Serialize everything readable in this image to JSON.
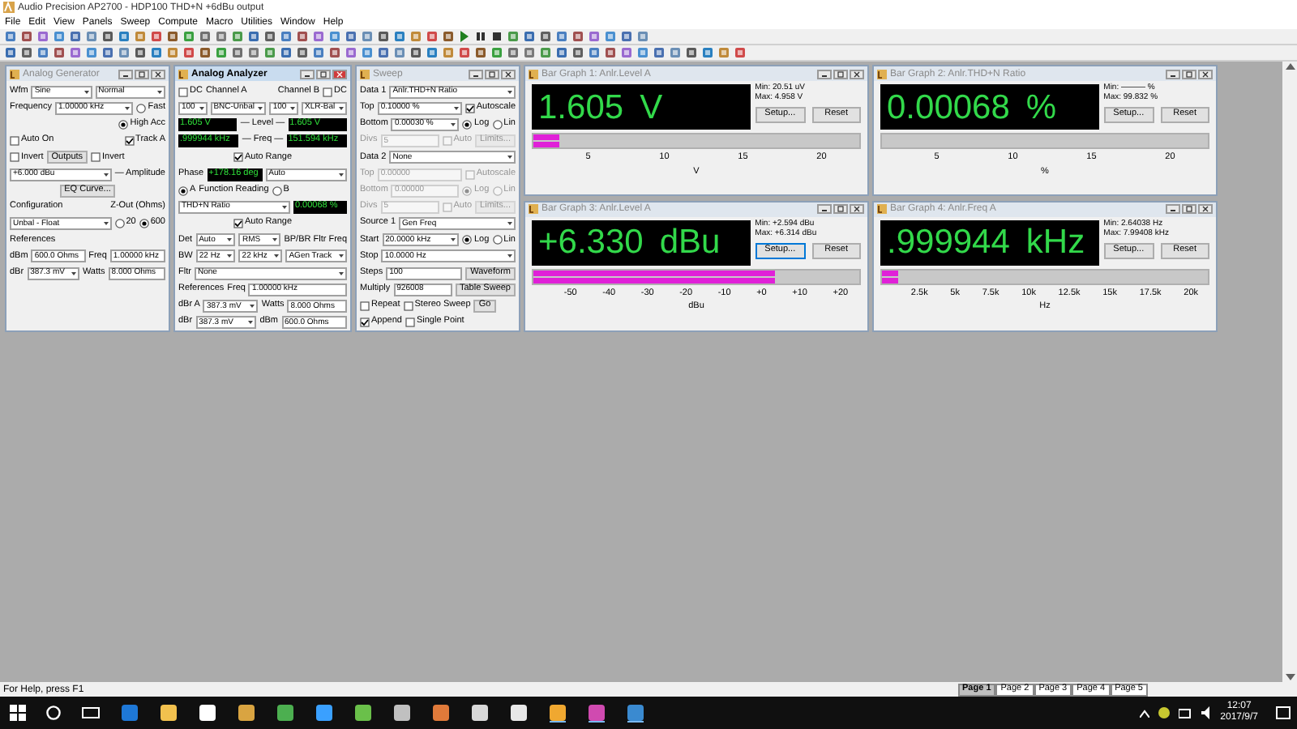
{
  "window": {
    "title": "Audio Precision AP2700 - HDP100 THD+N +6dBu output"
  },
  "menu": [
    "File",
    "Edit",
    "View",
    "Panels",
    "Sweep",
    "Compute",
    "Macro",
    "Utilities",
    "Window",
    "Help"
  ],
  "panels": [
    {
      "title": "Analog Generator",
      "active": false,
      "rows": [
        {
          "items": [
            {
              "kind": "label",
              "text": "Wfm"
            },
            {
              "kind": "select",
              "text": "Sine"
            },
            {
              "kind": "select",
              "text": "Normal"
            }
          ]
        },
        {
          "items": [
            {
              "kind": "label",
              "text": "Frequency"
            },
            {
              "kind": "select",
              "text": "1.00000 kHz"
            },
            {
              "kind": "radio",
              "text": "Fast",
              "selected": false
            }
          ]
        },
        {
          "items": [
            {
              "kind": "spacer"
            },
            {
              "kind": "radio",
              "text": "High Acc",
              "selected": true
            }
          ]
        },
        {
          "items": [
            {
              "kind": "checkbox",
              "text": "Auto On",
              "checked": false
            },
            {
              "kind": "spacer"
            },
            {
              "kind": "checkbox",
              "text": "Track A",
              "checked": true
            }
          ]
        },
        {
          "items": [
            {
              "kind": "checkbox",
              "text": "Invert",
              "checked": false
            },
            {
              "kind": "button",
              "text": "Outputs"
            },
            {
              "kind": "checkbox",
              "text": "Invert",
              "checked": false
            }
          ]
        },
        {
          "items": [
            {
              "kind": "select",
              "text": "+6.000 dBu"
            },
            {
              "kind": "label",
              "text": "— Amplitude"
            }
          ]
        },
        {
          "items": [
            {
              "kind": "spacer"
            },
            {
              "kind": "button",
              "text": "EQ Curve..."
            },
            {
              "kind": "spacer"
            }
          ]
        },
        {
          "items": [
            {
              "kind": "label",
              "text": "Configuration"
            },
            {
              "kind": "spacer"
            },
            {
              "kind": "label",
              "text": "Z-Out (Ohms)"
            }
          ]
        },
        {
          "items": [
            {
              "kind": "select",
              "text": "Unbal - Float"
            },
            {
              "kind": "radio",
              "text": "20",
              "selected": false
            },
            {
              "kind": "radio",
              "text": "600",
              "selected": true
            }
          ]
        },
        {
          "items": [
            {
              "kind": "label",
              "text": "References"
            }
          ]
        },
        {
          "items": [
            {
              "kind": "label",
              "text": "dBm"
            },
            {
              "kind": "input",
              "text": "600.0 Ohms"
            },
            {
              "kind": "label",
              "text": "Freq"
            },
            {
              "kind": "input",
              "text": "1.00000 kHz"
            }
          ]
        },
        {
          "items": [
            {
              "kind": "label",
              "text": "dBr"
            },
            {
              "kind": "select",
              "text": "387.3 mV"
            },
            {
              "kind": "label",
              "text": "Watts"
            },
            {
              "kind": "input",
              "text": "8.000 Ohms"
            }
          ]
        }
      ]
    },
    {
      "title": "Analog Analyzer",
      "active": true,
      "rows": [
        {
          "items": [
            {
              "kind": "checkbox",
              "text": "DC",
              "checked": false
            },
            {
              "kind": "label",
              "text": "Channel A"
            },
            {
              "kind": "spacer"
            },
            {
              "kind": "label",
              "text": "Channel B"
            },
            {
              "kind": "checkbox",
              "text": "DC",
              "checked": false
            }
          ]
        },
        {
          "items": [
            {
              "kind": "select",
              "text": "100"
            },
            {
              "kind": "select",
              "text": "BNC-Unbal"
            },
            {
              "kind": "select",
              "text": "100"
            },
            {
              "kind": "select",
              "text": "XLR-Bal"
            }
          ]
        },
        {
          "items": [
            {
              "kind": "display",
              "text": "1.605 V"
            },
            {
              "kind": "label",
              "text": "— Level —"
            },
            {
              "kind": "display",
              "text": "1.605 V"
            }
          ]
        },
        {
          "items": [
            {
              "kind": "display",
              "text": ".999944 kHz"
            },
            {
              "kind": "label",
              "text": "— Freq —"
            },
            {
              "kind": "display",
              "text": "151.594 kHz"
            }
          ]
        },
        {
          "items": [
            {
              "kind": "spacer"
            },
            {
              "kind": "checkbox",
              "text": "Auto Range",
              "checked": true
            },
            {
              "kind": "spacer"
            }
          ]
        },
        {
          "items": [
            {
              "kind": "label",
              "text": "Phase"
            },
            {
              "kind": "display",
              "text": "+178.16 deg"
            },
            {
              "kind": "select",
              "text": "Auto"
            }
          ]
        },
        {
          "items": [
            {
              "kind": "radio",
              "text": "A",
              "selected": true
            },
            {
              "kind": "label",
              "text": "Function Reading"
            },
            {
              "kind": "radio",
              "text": "B",
              "selected": false
            }
          ]
        },
        {
          "items": [
            {
              "kind": "select",
              "text": "THD+N Ratio"
            },
            {
              "kind": "display",
              "text": "0.00068 %"
            }
          ]
        },
        {
          "items": [
            {
              "kind": "spacer"
            },
            {
              "kind": "checkbox",
              "text": "Auto Range",
              "checked": true
            },
            {
              "kind": "spacer"
            }
          ]
        },
        {
          "items": [
            {
              "kind": "label",
              "text": "Det"
            },
            {
              "kind": "select",
              "text": "Auto"
            },
            {
              "kind": "select",
              "text": "RMS"
            },
            {
              "kind": "label",
              "text": "BP/BR Fltr Freq"
            }
          ]
        },
        {
          "items": [
            {
              "kind": "label",
              "text": "BW"
            },
            {
              "kind": "select",
              "text": "22 Hz"
            },
            {
              "kind": "select",
              "text": "22 kHz"
            },
            {
              "kind": "select",
              "text": "AGen Track"
            }
          ]
        },
        {
          "items": [
            {
              "kind": "label",
              "text": "Fltr"
            },
            {
              "kind": "select",
              "text": "None"
            }
          ]
        },
        {
          "items": [
            {
              "kind": "label",
              "text": "References"
            },
            {
              "kind": "label",
              "text": "Freq"
            },
            {
              "kind": "input",
              "text": "1.00000 kHz"
            }
          ]
        },
        {
          "items": [
            {
              "kind": "label",
              "text": "dBr A"
            },
            {
              "kind": "select",
              "text": "387.3 mV"
            },
            {
              "kind": "label",
              "text": "Watts"
            },
            {
              "kind": "input",
              "text": "8.000 Ohms"
            }
          ]
        },
        {
          "items": [
            {
              "kind": "label",
              "text": "dBr"
            },
            {
              "kind": "select",
              "text": "387.3 mV"
            },
            {
              "kind": "label",
              "text": "dBm"
            },
            {
              "kind": "input",
              "text": "600.0 Ohms"
            }
          ]
        }
      ]
    },
    {
      "title": "Sweep",
      "active": false,
      "rows": [
        {
          "disabled": false,
          "items": [
            {
              "kind": "label",
              "text": "Data 1"
            },
            {
              "kind": "select",
              "text": "Anlr.THD+N Ratio"
            }
          ]
        },
        {
          "disabled": false,
          "items": [
            {
              "kind": "label",
              "text": "Top"
            },
            {
              "kind": "select",
              "text": "0.10000 %"
            },
            {
              "kind": "checkbox",
              "text": "Autoscale",
              "checked": true
            }
          ]
        },
        {
          "disabled": false,
          "items": [
            {
              "kind": "label",
              "text": "Bottom"
            },
            {
              "kind": "select",
              "text": "0.00030 %"
            },
            {
              "kind": "radio",
              "text": "Log",
              "selected": true
            },
            {
              "kind": "radio",
              "text": "Lin",
              "selected": false
            }
          ]
        },
        {
          "disabled": true,
          "items": [
            {
              "kind": "label",
              "text": "Divs"
            },
            {
              "kind": "input",
              "text": "5"
            },
            {
              "kind": "checkbox",
              "text": "Auto",
              "checked": false
            },
            {
              "kind": "button",
              "text": "Limits..."
            }
          ]
        },
        {
          "disabled": false,
          "items": [
            {
              "kind": "label",
              "text": "Data 2"
            },
            {
              "kind": "select",
              "text": "None"
            }
          ]
        },
        {
          "disabled": true,
          "items": [
            {
              "kind": "label",
              "text": "Top"
            },
            {
              "kind": "input",
              "text": "0.00000"
            },
            {
              "kind": "checkbox",
              "text": "Autoscale",
              "checked": false
            }
          ]
        },
        {
          "disabled": true,
          "items": [
            {
              "kind": "label",
              "text": "Bottom"
            },
            {
              "kind": "input",
              "text": "0.00000"
            },
            {
              "kind": "radio",
              "text": "Log",
              "selected": true
            },
            {
              "kind": "radio",
              "text": "Lin",
              "selected": false
            }
          ]
        },
        {
          "disabled": true,
          "items": [
            {
              "kind": "label",
              "text": "Divs"
            },
            {
              "kind": "input",
              "text": "5"
            },
            {
              "kind": "checkbox",
              "text": "Auto",
              "checked": false
            },
            {
              "kind": "button",
              "text": "Limits..."
            }
          ]
        },
        {
          "disabled": false,
          "items": [
            {
              "kind": "label",
              "text": "Source 1"
            },
            {
              "kind": "select",
              "text": "Gen Freq"
            }
          ]
        },
        {
          "disabled": false,
          "items": [
            {
              "kind": "label",
              "text": "Start"
            },
            {
              "kind": "select",
              "text": "20.0000 kHz"
            },
            {
              "kind": "radio",
              "text": "Log",
              "selected": true
            },
            {
              "kind": "radio",
              "text": "Lin",
              "selected": false
            }
          ]
        },
        {
          "disabled": false,
          "items": [
            {
              "kind": "label",
              "text": "Stop"
            },
            {
              "kind": "select",
              "text": "10.0000 Hz"
            }
          ]
        },
        {
          "disabled": false,
          "items": [
            {
              "kind": "label",
              "text": "Steps"
            },
            {
              "kind": "input",
              "text": "100"
            },
            {
              "kind": "button",
              "text": "Waveform"
            }
          ]
        },
        {
          "disabled": false,
          "items": [
            {
              "kind": "label",
              "text": "Multiply"
            },
            {
              "kind": "input",
              "text": "926008"
            },
            {
              "kind": "button",
              "text": "Table Sweep"
            }
          ]
        },
        {
          "disabled": false,
          "items": [
            {
              "kind": "checkbox",
              "text": "Repeat",
              "checked": false
            },
            {
              "kind": "checkbox",
              "text": "Stereo Sweep",
              "checked": false
            },
            {
              "kind": "button",
              "text": "Go"
            }
          ]
        },
        {
          "disabled": false,
          "items": [
            {
              "kind": "checkbox",
              "text": "Append",
              "checked": true
            },
            {
              "kind": "checkbox",
              "text": "Single Point",
              "checked": false
            }
          ]
        }
      ]
    }
  ],
  "bar_graphs": [
    {
      "title": "Bar Graph 1: Anlr.Level A",
      "reading": "1.605",
      "unit": "V",
      "min": "Min: 20.51 uV",
      "max": "Max: 4.958 V",
      "level": 0.08,
      "ticks": [
        "5",
        "10",
        "15",
        "20"
      ],
      "axis_label": "V",
      "setup": "Setup...",
      "reset": "Reset",
      "setup_focused": false
    },
    {
      "title": "Bar Graph 2: Anlr.THD+N Ratio",
      "reading": "0.00068",
      "unit": "%",
      "min": "Min: ——— %",
      "max": "Max: 99.832 %",
      "level": 0.0,
      "ticks": [
        "5",
        "10",
        "15",
        "20"
      ],
      "axis_label": "%",
      "setup": "Setup...",
      "reset": "Reset",
      "setup_focused": false
    },
    {
      "title": "Bar Graph 3: Anlr.Level A",
      "reading": "+6.330",
      "unit": "dBu",
      "min": "Min: +2.594 dBu",
      "max": "Max: +6.314 dBu",
      "level": 0.74,
      "ticks": [
        "-50",
        "-40",
        "-30",
        "-20",
        "-10",
        "+0",
        "+10",
        "+20"
      ],
      "axis_label": "dBu",
      "setup": "Setup...",
      "reset": "Reset",
      "setup_focused": true
    },
    {
      "title": "Bar Graph 4: Anlr.Freq A",
      "reading": ".999944",
      "unit": "kHz",
      "min": "Min: 2.64038 Hz",
      "max": "Max: 7.99408 kHz",
      "level": 0.05,
      "ticks": [
        "2.5k",
        "5k",
        "7.5k",
        "10k",
        "12.5k",
        "15k",
        "17.5k",
        "20k"
      ],
      "axis_label": "Hz",
      "setup": "Setup...",
      "reset": "Reset",
      "setup_focused": false
    }
  ],
  "status_bar": {
    "text": "For Help, press F1",
    "pages": [
      {
        "label": "Page 1",
        "selected": true
      },
      {
        "label": "Page 2",
        "selected": false
      },
      {
        "label": "Page 3",
        "selected": false
      },
      {
        "label": "Page 4",
        "selected": false
      },
      {
        "label": "Page 5",
        "selected": false
      }
    ]
  },
  "taskbar": {
    "time": "12:07",
    "date": "2017/9/7"
  }
}
